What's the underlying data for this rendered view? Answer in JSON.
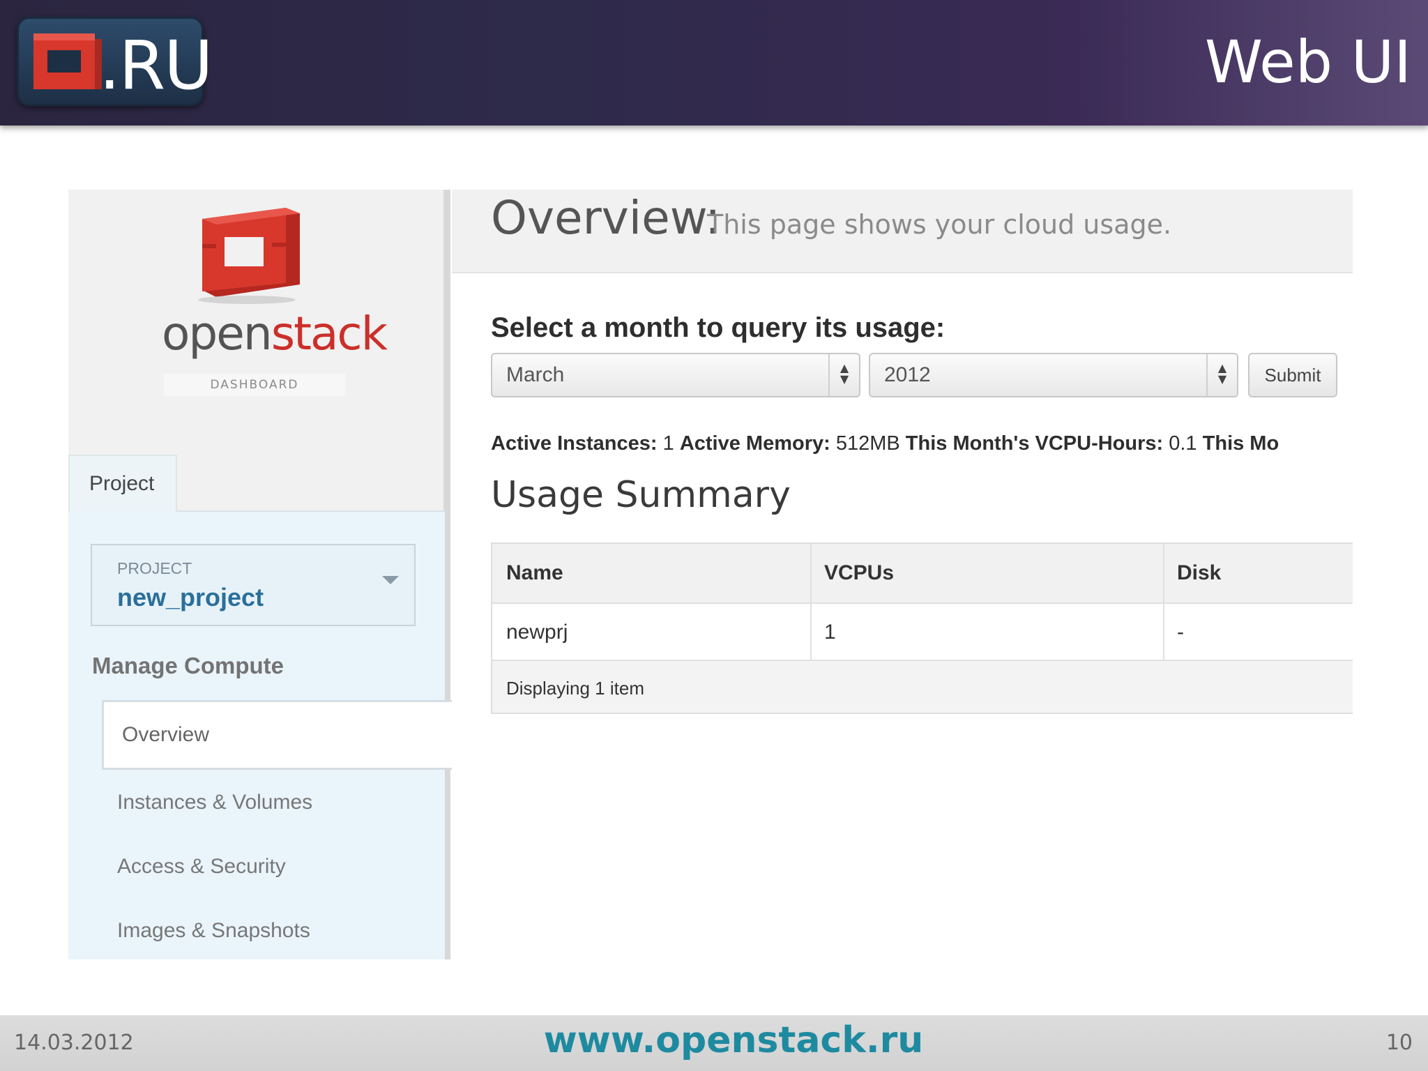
{
  "slide": {
    "logo_text": ".RU",
    "title": "Web UI",
    "footer_date": "14.03.2012",
    "footer_url": "www.openstack.ru",
    "page_number": "10"
  },
  "sidebar": {
    "brand_open": "open",
    "brand_stack": "stack",
    "brand_sub": "DASHBOARD",
    "tab_label": "Project",
    "project_label": "PROJECT",
    "project_name": "new_project",
    "nav_heading": "Manage Compute",
    "items": [
      {
        "label": "Overview",
        "active": true
      },
      {
        "label": "Instances & Volumes"
      },
      {
        "label": "Access & Security"
      },
      {
        "label": "Images & Snapshots"
      }
    ]
  },
  "main": {
    "title": "Overview:",
    "subtitle": "This page shows your cloud usage.",
    "select_heading": "Select a month to query its usage:",
    "month_value": "March",
    "year_value": "2012",
    "submit_label": "Submit",
    "stats": {
      "instances_label": "Active Instances:",
      "instances_value": "1",
      "memory_label": "Active Memory:",
      "memory_value": "512MB",
      "vcpu_label": "This Month's VCPU-Hours:",
      "vcpu_value": "0.1",
      "truncated_label": "This Mo"
    },
    "usage_heading": "Usage Summary",
    "table": {
      "headers": [
        "Name",
        "VCPUs",
        "Disk"
      ],
      "rows": [
        [
          "newprj",
          "1",
          "-"
        ]
      ],
      "footer": "Displaying 1 item"
    }
  },
  "colors": {
    "brand_red": "#cc2f2a",
    "link_blue": "#2a6f9a",
    "footer_url": "#1e8aa0"
  }
}
